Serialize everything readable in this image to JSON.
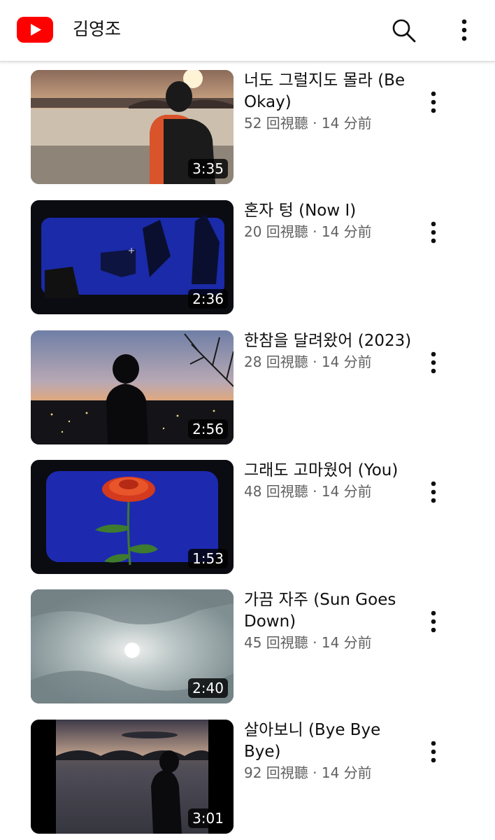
{
  "header": {
    "channel_name": "김영조",
    "logo_icon": "youtube-logo-icon",
    "search_icon": "search-icon",
    "menu_icon": "more-vertical-icon",
    "brand_color": "#ff0000"
  },
  "videos": [
    {
      "title": "너도 그럴지도 몰라 (Be Okay)",
      "stats": "52 回視聽 · 14 分前",
      "duration": "3:35"
    },
    {
      "title": "혼자 텅 (Now I)",
      "stats": "20 回視聽 · 14 分前",
      "duration": "2:36"
    },
    {
      "title": "한참을 달려왔어 (2023)",
      "stats": "28 回視聽 · 14 分前",
      "duration": "2:56"
    },
    {
      "title": "그래도 고마웠어 (You)",
      "stats": "48 回視聽 · 14 分前",
      "duration": "1:53"
    },
    {
      "title": "가끔 자주 (Sun Goes Down)",
      "stats": "45 回視聽 · 14 分前",
      "duration": "2:40"
    },
    {
      "title": "살아보니 (Bye Bye Bye)",
      "stats": "92 回視聽 · 14 分前",
      "duration": "3:01"
    }
  ],
  "colors": {
    "text_primary": "#0f0f0f",
    "text_secondary": "#606060",
    "duration_badge": "#000000"
  }
}
